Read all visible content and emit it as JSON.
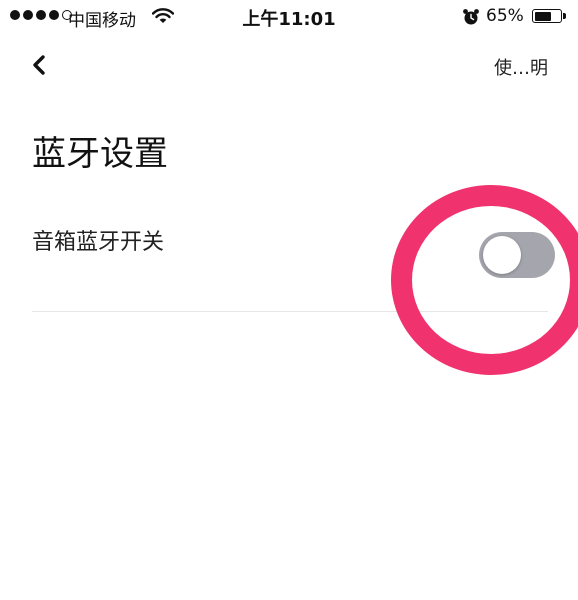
{
  "status_bar": {
    "carrier": "中国移动",
    "time": "上午11:01",
    "battery_percent": "65%",
    "battery_level": 0.65,
    "signal_bars_filled": 4,
    "signal_bars_total": 5,
    "icons": [
      "signal-icon",
      "wifi-icon",
      "alarm-icon",
      "battery-icon"
    ]
  },
  "nav": {
    "back_icon": "chevron-left-icon",
    "help_label": "使…明"
  },
  "page": {
    "title": "蓝牙设置"
  },
  "settings": [
    {
      "label": "音箱蓝牙开关",
      "toggle_on": false
    }
  ],
  "colors": {
    "toggle_off": "#a5a5ad",
    "annotation_circle": "#f0336e"
  }
}
